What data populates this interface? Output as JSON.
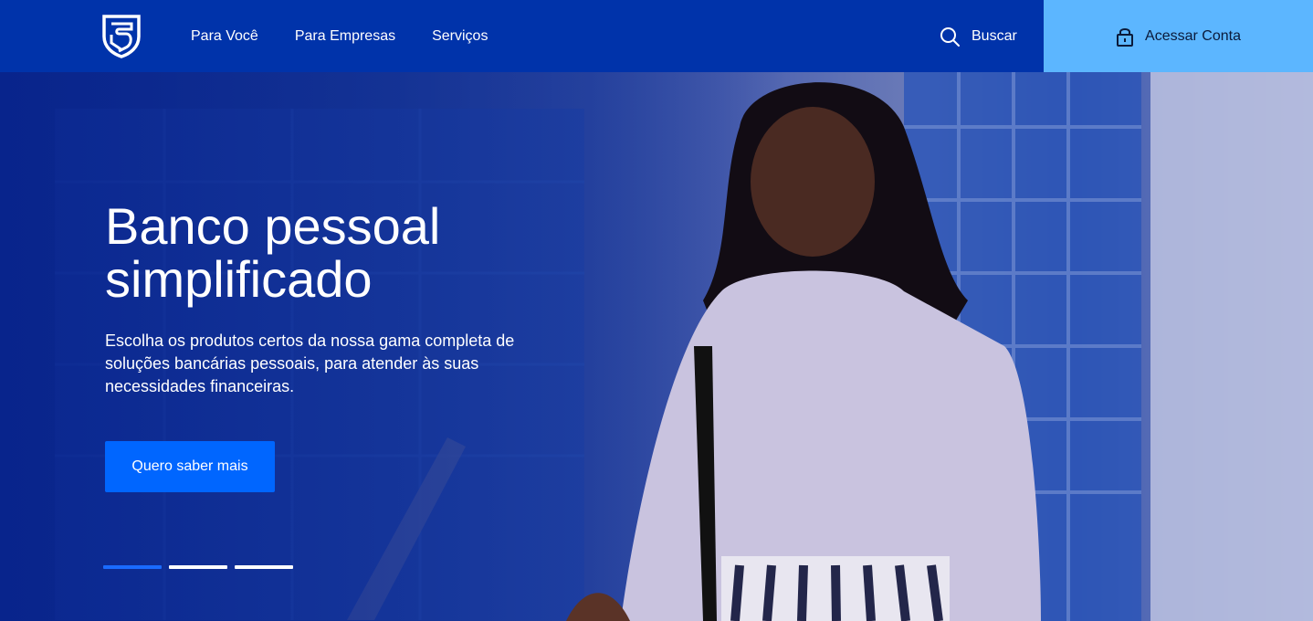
{
  "nav": {
    "items": [
      {
        "label": "Para Você"
      },
      {
        "label": "Para Empresas"
      },
      {
        "label": "Serviços"
      }
    ],
    "search_label": "Buscar",
    "login_label": "Acessar Conta"
  },
  "hero": {
    "title": "Banco pessoal simplificado",
    "description": "Escolha os produtos certos da nossa gama completa de soluções bancárias pessoais, para atender às suas necessidades financeiras.",
    "cta_label": "Quero saber mais",
    "carousel": {
      "slides": 3,
      "active_index": 0
    }
  },
  "colors": {
    "header_bg": "#0033aa",
    "login_bg": "#5cb6ff",
    "cta_bg": "#0066ff",
    "indicator_active": "#1a6bff"
  },
  "icons": [
    "logo-shield-icon",
    "search-icon",
    "lock-icon"
  ]
}
